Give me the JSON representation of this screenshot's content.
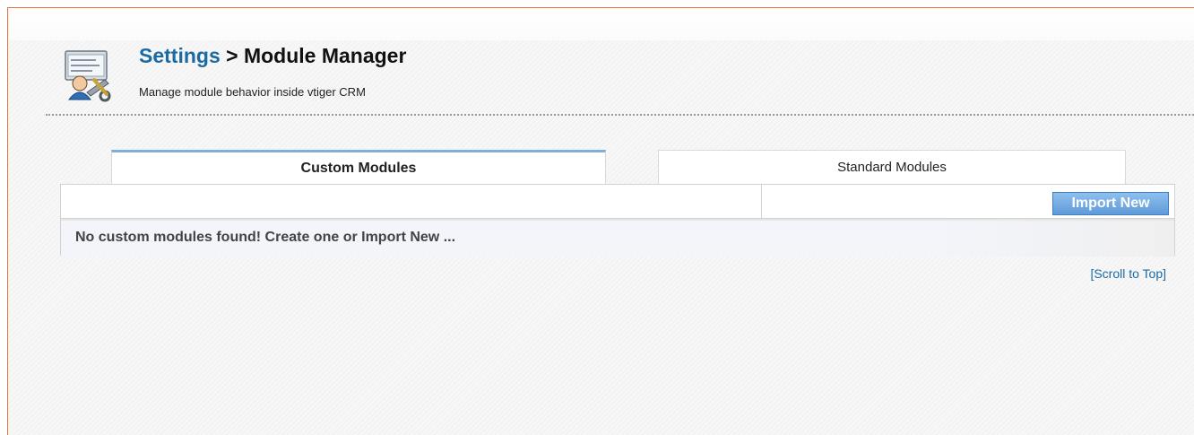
{
  "header": {
    "breadcrumb_link": "Settings",
    "separator": " > ",
    "title": "Module Manager",
    "subtitle": "Manage module behavior inside vtiger CRM",
    "icon": "settings-tools-icon"
  },
  "tabs": [
    {
      "label": "Custom Modules",
      "active": true
    },
    {
      "label": "Standard Modules",
      "active": false
    }
  ],
  "toolbar": {
    "import_label": "Import New"
  },
  "content": {
    "empty_message": "No custom modules found! Create one or Import New ..."
  },
  "footer": {
    "scroll_to_top": "[Scroll to Top]"
  },
  "colors": {
    "frame_border": "#e9733f",
    "link": "#1c6aa3",
    "button": "#5f9ad8",
    "active_tab_border": "#7fb0dc"
  }
}
